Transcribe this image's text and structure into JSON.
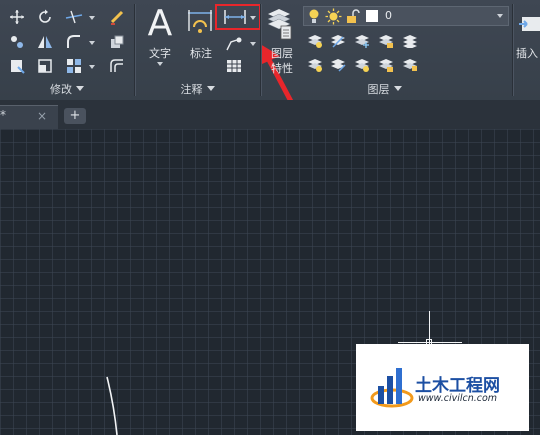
{
  "ribbon": {
    "panels": {
      "modify": "修改",
      "annotation": "注释",
      "layers": "图层"
    },
    "text_button": "文字",
    "dimension_button": "标注",
    "layer_props_line1": "图层",
    "layer_props_line2": "特性",
    "insert_button": "插入",
    "current_layer": "0"
  },
  "tabs": {
    "doc_name": "*",
    "close": "×",
    "add": "+"
  },
  "watermark": {
    "title": "土木工程网",
    "url": "www.civilcn.com"
  },
  "colors": {
    "highlight": "#e8262b",
    "ribbon_bg": "#3b434e",
    "canvas_bg": "#212830"
  }
}
